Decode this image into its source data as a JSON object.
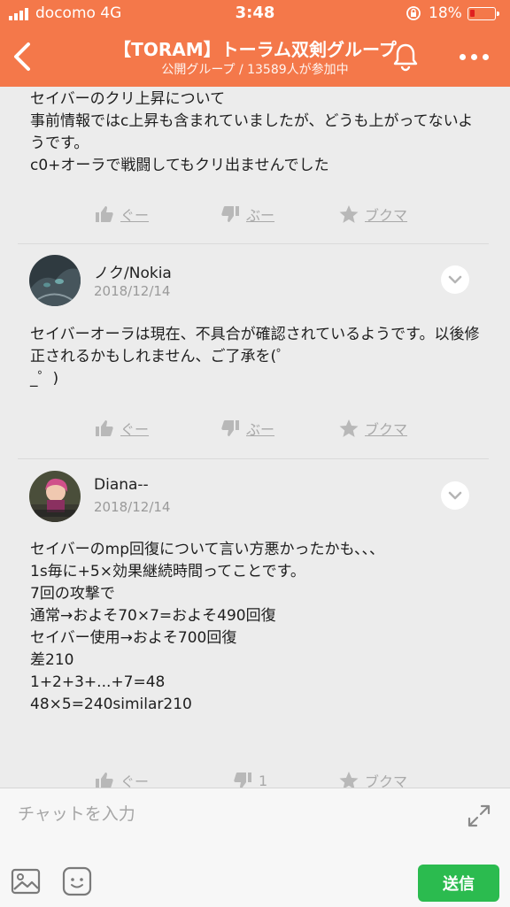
{
  "status_bar": {
    "carrier": "docomo   4G",
    "time": "3:48",
    "battery": "18%"
  },
  "header": {
    "title": "【TORAM】トーラム双剣グループ",
    "subtitle": "公開グループ / 13589人が参加中"
  },
  "posts": [
    {
      "text": "セイバーのクリ上昇について\n事前情報ではc上昇も含まれていましたが、どうも上がってないようです。\nc0+オーラで戦闘してもクリ出ませんでした",
      "reactions": {
        "like": "ぐー",
        "dislike": "ぶー",
        "bookmark": "ブクマ"
      }
    }
  ],
  "comments": [
    {
      "user": "ノク/Nokia",
      "date": "2018/12/14",
      "text": "セイバーオーラは現在、不具合が確認されているようです。以後修正されるかもしれません、ご了承を(゜\n_゜)",
      "reactions": {
        "like": "ぐー",
        "dislike": "ぶー",
        "bookmark": "ブクマ"
      }
    },
    {
      "user": "Diana--",
      "date": "2018/12/14",
      "text": "セイバーのmp回復について言い方悪かったかも、、、\n1s毎に+5×効果継続時間ってことです。\n7回の攻撃で\n通常→およそ70×7=およそ490回復\nセイバー使用→およそ700回復\n差210\n1+2+3+...+7=48\n48×5=240similar210",
      "reactions": {
        "like": "ぐー",
        "dislike": "1",
        "bookmark": "ブクマ"
      }
    }
  ],
  "input": {
    "placeholder": "チャットを入力",
    "send_label": "送信"
  },
  "colors": {
    "header": "#f4784a",
    "send_button": "#2bbb4f"
  }
}
